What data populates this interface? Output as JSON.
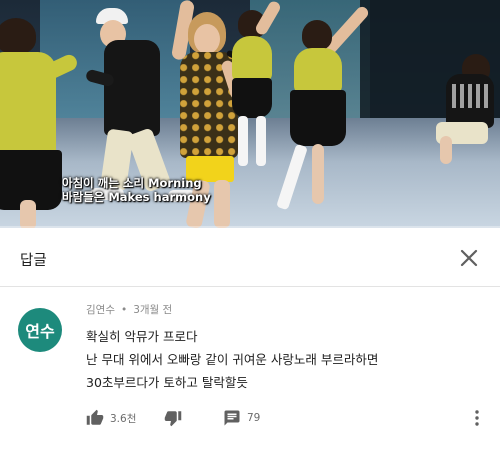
{
  "video": {
    "subtitle_line1": "아침이 깨는 소리 Morning",
    "subtitle_line2": "바람들은 Makes harmony",
    "progress": 0.0
  },
  "reply_panel": {
    "title": "답글",
    "close_icon": "close-icon"
  },
  "comment": {
    "avatar_text": "연수",
    "avatar_color": "#1d8a7c",
    "author": "김연수",
    "separator": "•",
    "time": "3개월 전",
    "lines": [
      "확실히 악뮤가 프로다",
      "난 무대 위에서 오빠랑 같이 귀여운 사랑노래 부르라하면",
      "30초부르다가 토하고 탈락할듯"
    ],
    "like_count": "3.6천",
    "reply_count": "79",
    "icons": {
      "like": "thumbs-up-icon",
      "dislike": "thumbs-down-icon",
      "reply": "comment-icon",
      "more": "more-vert-icon"
    }
  }
}
